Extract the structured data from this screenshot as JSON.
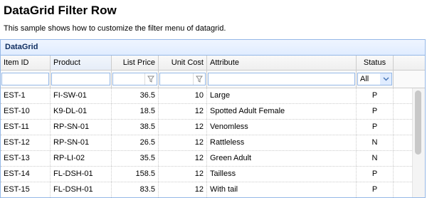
{
  "page": {
    "title": "DataGrid Filter Row",
    "description": "This sample shows how to customize the filter menu of datagrid."
  },
  "grid": {
    "title": "DataGrid",
    "columns": {
      "itemid": "Item ID",
      "productid": "Product",
      "listprice": "List Price",
      "unitcost": "Unit Cost",
      "attr1": "Attribute",
      "status": "Status"
    },
    "filter": {
      "status_selected": "All"
    },
    "rows": [
      {
        "itemid": "EST-1",
        "productid": "FI-SW-01",
        "listprice": "36.5",
        "unitcost": "10",
        "attr1": "Large",
        "status": "P"
      },
      {
        "itemid": "EST-10",
        "productid": "K9-DL-01",
        "listprice": "18.5",
        "unitcost": "12",
        "attr1": "Spotted Adult Female",
        "status": "P"
      },
      {
        "itemid": "EST-11",
        "productid": "RP-SN-01",
        "listprice": "38.5",
        "unitcost": "12",
        "attr1": "Venomless",
        "status": "P"
      },
      {
        "itemid": "EST-12",
        "productid": "RP-SN-01",
        "listprice": "26.5",
        "unitcost": "12",
        "attr1": "Rattleless",
        "status": "N"
      },
      {
        "itemid": "EST-13",
        "productid": "RP-LI-02",
        "listprice": "35.5",
        "unitcost": "12",
        "attr1": "Green Adult",
        "status": "N"
      },
      {
        "itemid": "EST-14",
        "productid": "FL-DSH-01",
        "listprice": "158.5",
        "unitcost": "12",
        "attr1": "Tailless",
        "status": "P"
      },
      {
        "itemid": "EST-15",
        "productid": "FL-DSH-01",
        "listprice": "83.5",
        "unitcost": "12",
        "attr1": "With tail",
        "status": "P"
      }
    ]
  },
  "icons": {
    "filter": "filter-funnel-icon",
    "dropdown": "chevron-down-icon"
  },
  "colors": {
    "border": "#95b8e7",
    "title_text": "#0e2d5f"
  }
}
